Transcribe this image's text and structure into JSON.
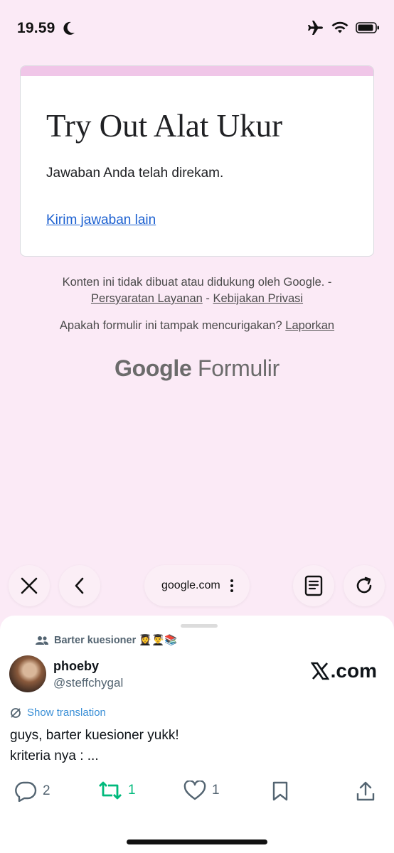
{
  "status_bar": {
    "time": "19.59"
  },
  "form": {
    "title": "Try Out Alat Ukur",
    "message": "Jawaban Anda telah direkam.",
    "link": "Kirim jawaban lain"
  },
  "footer": {
    "disclaimer": "Konten ini tidak dibuat atau didukung oleh Google. -",
    "terms_link": "Persyaratan Layanan",
    "separator": "-",
    "privacy_link": "Kebijakan Privasi",
    "report_prompt": "Apakah formulir ini tampak mencurigakan?",
    "report_link": "Laporkan",
    "logo_google": "Google",
    "logo_product": "Formulir"
  },
  "browser": {
    "url": "google.com"
  },
  "tweet": {
    "community": "Barter kuesioner 👩‍🎓👨‍🎓📚",
    "display_name": "phoeby",
    "handle": "@steffchygal",
    "source": ".com",
    "translate_label": "Show translation",
    "text_line1": "guys, barter kuesioner yukk!",
    "text_line2": "kriteria nya : ...",
    "replies": "2",
    "retweets": "1",
    "likes": "1"
  },
  "colors": {
    "page_bg": "#fbeaf6",
    "card_accent": "#f0c6e8",
    "link_blue": "#1a5fd0",
    "retweet_green": "#00ba7c",
    "translate_blue": "#3a8fd6"
  }
}
